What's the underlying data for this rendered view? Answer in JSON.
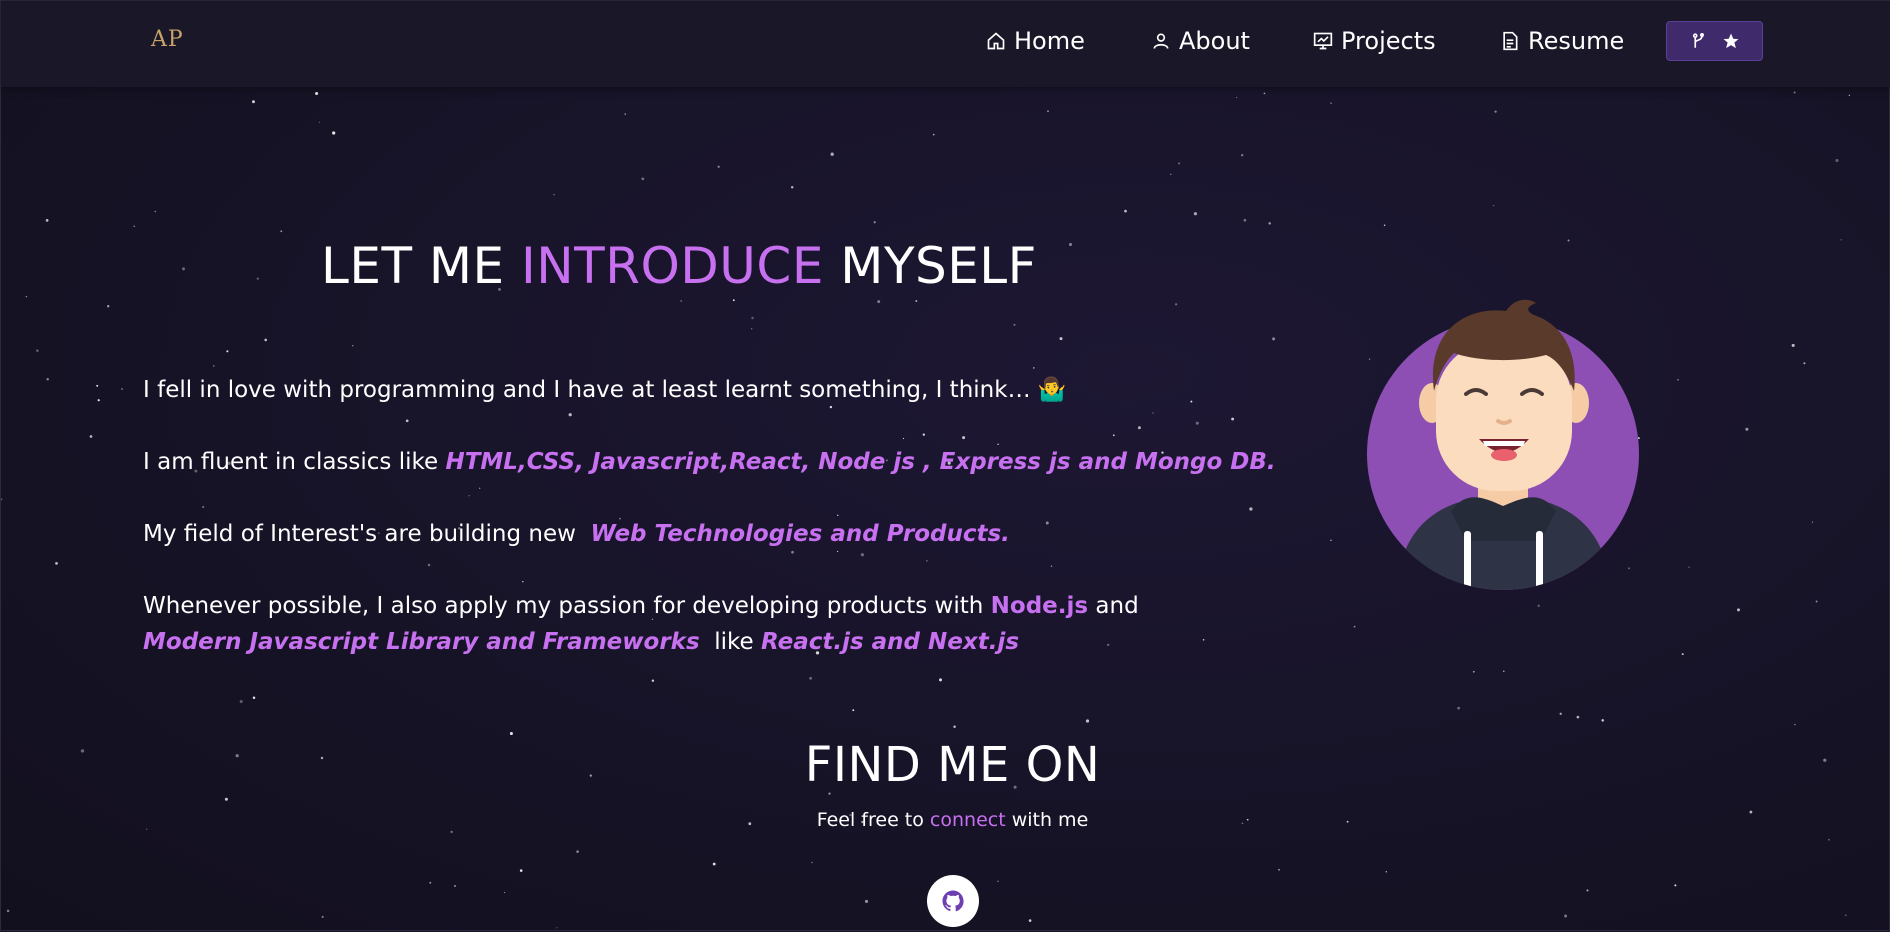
{
  "brand": {
    "logo_text": "AP"
  },
  "nav": {
    "home": "Home",
    "about": "About",
    "projects": "Projects",
    "resume": "Resume",
    "repo_button_icons": [
      "git-fork-icon",
      "star-icon"
    ]
  },
  "about": {
    "heading_pre": "LET ME ",
    "heading_accent": "INTRODUCE",
    "heading_post": " MYSELF",
    "p1": "I fell in love with programming and I have at least learnt something, I think… 🤷‍♂️",
    "p2_pre": "I am fluent in classics like ",
    "p2_accent": "HTML,CSS, Javascript,React, Node js , Express js and Mongo DB.",
    "p3_pre": "My field of Interest's are building new  ",
    "p3_accent": "Web Technologies and Products.",
    "p4_pre": "Whenever possible, I also apply my passion for developing products with ",
    "p4_accent1": "Node.js",
    "p4_mid": " and ",
    "p4_accent2": "Modern Javascript Library and Frameworks",
    "p4_mid2": "  like ",
    "p4_accent3": "React.js and Next.js"
  },
  "social": {
    "title": "FIND ME ON",
    "sub_pre": "Feel free to ",
    "sub_accent": "connect",
    "sub_post": " with me",
    "icons": [
      "github-icon"
    ]
  },
  "colors": {
    "background": "#181428",
    "accent": "#c770f0",
    "navbar": "#1a1729",
    "button": "#3f2a6b",
    "avatar_circle": "#8e4fb5"
  }
}
